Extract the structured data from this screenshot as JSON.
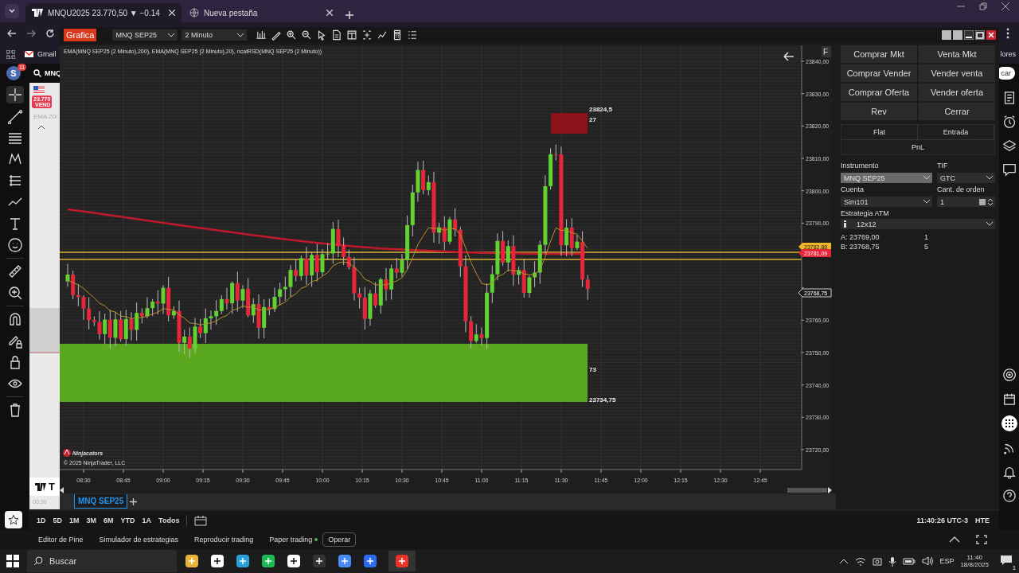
{
  "browser": {
    "tabs": [
      {
        "title": "MNQU2025 23.770,50 ▼ −0.14",
        "selected": true
      },
      {
        "title": "Nueva pestaña",
        "selected": false
      }
    ],
    "bookmarks": [
      {
        "label": "Gmail"
      }
    ],
    "bookmark_cut": "lores"
  },
  "tradingview": {
    "avatar": "S",
    "avatar_badge": "11",
    "symbol_search": "MNQ",
    "search_button": "car",
    "quote_price": "23.770",
    "quote_side": "VEND",
    "indicator_stub": "EMA 20/",
    "logo_letter": "T",
    "time_stub": "00:30",
    "ranges": [
      "1D",
      "5D",
      "1M",
      "3M",
      "6M",
      "YTD",
      "1A",
      "Todos"
    ],
    "clock": "11:40:26 UTC-3",
    "session": "HTE",
    "panels": [
      {
        "label": "Editor de Pine",
        "kind": "plain"
      },
      {
        "label": "Simulador de estrategias",
        "kind": "plain"
      },
      {
        "label": "Reproducir trading",
        "kind": "plain"
      },
      {
        "label": "Paper trading",
        "kind": "status"
      },
      {
        "label": "Operar",
        "kind": "outlined"
      }
    ]
  },
  "ninjatrader": {
    "badge": "Grafica",
    "instrument": "MNQ SEP25",
    "interval": "2 Minuto",
    "indicators": "EMA(MNQ SEP25 (2 Minuto),200), EMA(MNQ SEP25 (2 Minuto),20), ncatRSD(MNQ SEP25 (2 Minuto))",
    "axis_button": "F",
    "price_ticks_upper": [
      "23840,00",
      "23830,00",
      "23820,00",
      "23810,00",
      "23800,00",
      "23790,00"
    ],
    "price_ticks_lower": [
      "23760,00",
      "23750,00",
      "23740,00",
      "23730,00",
      "23720,00"
    ],
    "time_ticks": [
      "08:30",
      "08:45",
      "09:00",
      "09:15",
      "09:30",
      "09:45",
      "10:00",
      "10:15",
      "10:30",
      "10:45",
      "11:00",
      "11:15",
      "11:30",
      "11:45",
      "12:00",
      "12:15",
      "12:30",
      "12:45"
    ],
    "supply_zone": {
      "price": "23824,5",
      "count": "27"
    },
    "demand_zone": {
      "count": "73",
      "price": "23734,75"
    },
    "price_flags": [
      {
        "value": "23782,88",
        "color": "#f0b429"
      },
      {
        "value": "23781,09",
        "color": "#e8253b"
      },
      {
        "value": "23768,75",
        "color": "#1c1c1c"
      }
    ],
    "brand": "Ninjacators",
    "copyright": "© 2025 NinjaTrader, LLC",
    "chart_tabs": [
      {
        "label": "MNQ SEP25",
        "selected": true
      }
    ],
    "order_panel": {
      "buttons": [
        "Comprar Mkt",
        "Venta Mkt",
        "Comprar Vender",
        "Vender venta",
        "Comprar Oferta",
        "Vender oferta",
        "Rev",
        "Cerrar"
      ],
      "position": {
        "columns": [
          "Flat",
          "Entrada"
        ],
        "pnl": "PnL"
      },
      "instrument": {
        "label": "Instrumento",
        "value": "MNQ SEP25",
        "disabled": true
      },
      "tif": {
        "label": "TIF",
        "value": "GTC"
      },
      "account": {
        "label": "Cuenta",
        "value": "Sim101"
      },
      "quantity": {
        "label": "Cant. de orden",
        "value": "1"
      },
      "atm": {
        "label": "Estrategia ATM",
        "value": "12x12"
      },
      "quotes": [
        {
          "label": "A:",
          "price": "23769,00",
          "size": "1"
        },
        {
          "label": "B:",
          "price": "23768,75",
          "size": "5"
        }
      ]
    }
  },
  "taskbar": {
    "search_placeholder": "Buscar",
    "language": "ESP",
    "time": "11:40",
    "date": "18/8/2025",
    "notification_badge": "1"
  }
}
